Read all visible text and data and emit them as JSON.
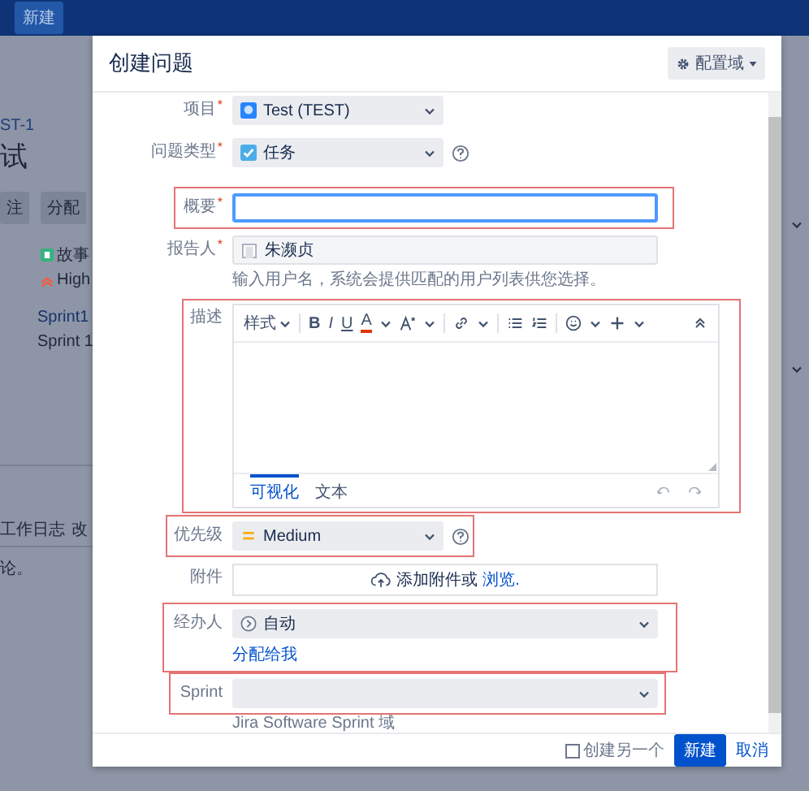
{
  "top_bar": {
    "create_button": "新建"
  },
  "background_page": {
    "issue_key": "ST-1",
    "issue_title": "试",
    "actions": [
      "注",
      "分配"
    ],
    "type": "故事",
    "priority": "High",
    "sprint_tag": "Sprint1",
    "sprint": "Sprint 1",
    "tabs": [
      "工作日志",
      "改"
    ],
    "comment_text": "论。"
  },
  "dialog": {
    "title": "创建问题",
    "configure_button": "配置域",
    "fields": [
      {
        "kind": "project",
        "label": "项目",
        "required_mark": "*",
        "value": "Test (TEST)"
      },
      {
        "kind": "issue_type",
        "label": "问题类型",
        "required_mark": "*",
        "value": "任务",
        "help": true
      },
      {
        "kind": "divider"
      },
      {
        "kind": "summary",
        "label": "概要",
        "required_mark": "*",
        "focused": true,
        "highlighted": true
      },
      {
        "kind": "reporter",
        "label": "报告人",
        "required_mark": "*",
        "value": "朱濒贞",
        "hint": "输入用户名，系统会提供匹配的用户列表供您选择。"
      },
      {
        "kind": "description",
        "label": "描述",
        "toolbar": {
          "style_menu": "样式",
          "bold": "B",
          "italic": "I",
          "underline": "U",
          "font_color": "A"
        },
        "modes": [
          {
            "label": "可视化",
            "selected": true
          },
          {
            "label": "文本",
            "selected": false
          }
        ],
        "highlighted": true
      },
      {
        "kind": "priority",
        "label": "优先级",
        "value": "Medium",
        "help": true,
        "highlighted": true
      },
      {
        "kind": "attachment",
        "label": "附件",
        "prompt": "添加附件或",
        "link": "浏览."
      },
      {
        "kind": "assignee",
        "label": "经办人",
        "value": "自动",
        "link": "分配给我",
        "highlighted": true
      },
      {
        "kind": "sprint",
        "label": "Sprint",
        "hint": "Jira Software Sprint 域",
        "highlighted": true
      }
    ],
    "footer": {
      "create_another": {
        "label": "创建另一个",
        "checked": false
      },
      "submit": "新建",
      "cancel": "取消"
    }
  }
}
